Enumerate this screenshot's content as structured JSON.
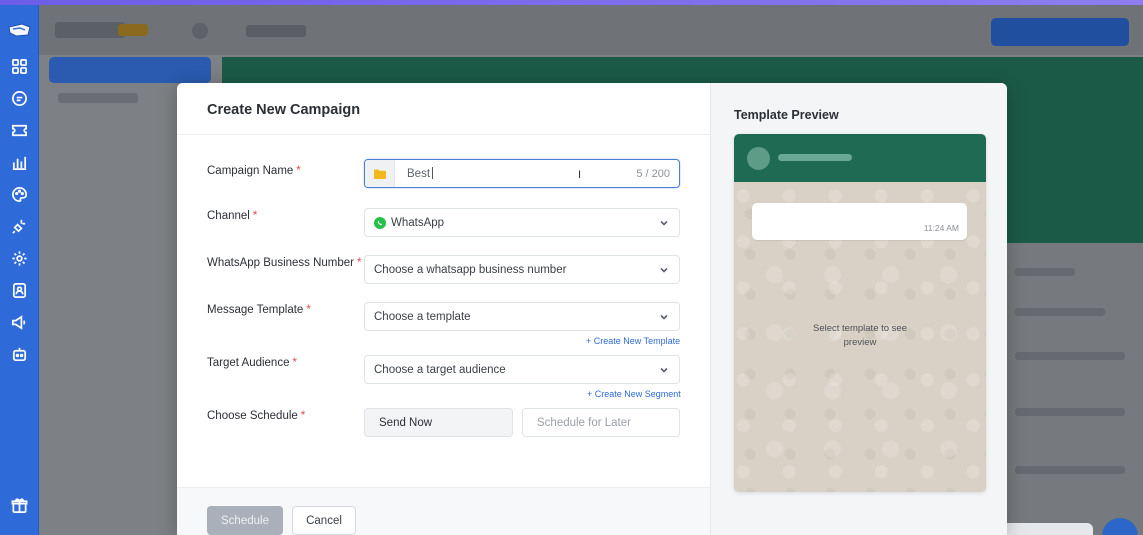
{
  "modal": {
    "title": "Create New Campaign",
    "fields": {
      "campaign_name": {
        "label": "Campaign Name",
        "value": "Best",
        "counter": "5 / 200"
      },
      "channel": {
        "label": "Channel",
        "value": "WhatsApp"
      },
      "business_number": {
        "label": "WhatsApp Business Number",
        "placeholder": "Choose a whatsapp business number"
      },
      "message_template": {
        "label": "Message Template",
        "placeholder": "Choose a template",
        "link": "+ Create New Template"
      },
      "target_audience": {
        "label": "Target Audience",
        "placeholder": "Choose a target audience",
        "link": "+ Create New Segment"
      },
      "schedule": {
        "label": "Choose Schedule",
        "option_now": "Send Now",
        "option_later": "Schedule for Later"
      }
    },
    "required_mark": "*",
    "footer": {
      "primary": "Schedule",
      "cancel": "Cancel"
    }
  },
  "preview": {
    "title": "Template Preview",
    "bubble_time": "11:24 AM",
    "empty_text": "Select template to see preview"
  },
  "colors": {
    "sidebar": "#2f6bd8",
    "whatsapp_green": "#25c04a",
    "preview_header": "#1f6a53",
    "required": "#e24b4b",
    "link": "#2f6bd8"
  },
  "icons": {
    "sidebar": [
      "logo-icon",
      "dashboard-icon",
      "chat-icon",
      "ticket-icon",
      "analytics-icon",
      "palette-icon",
      "plug-icon",
      "settings-icon",
      "contacts-icon",
      "campaign-icon",
      "bot-icon",
      "gift-icon"
    ]
  }
}
